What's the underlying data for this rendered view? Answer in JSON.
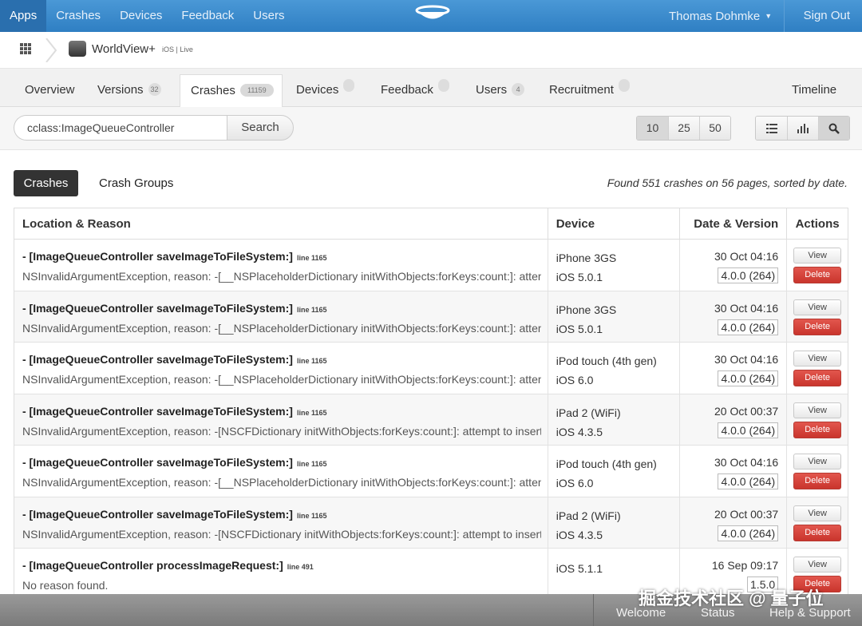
{
  "topnav": {
    "items": [
      "Apps",
      "Crashes",
      "Devices",
      "Feedback",
      "Users"
    ],
    "user": "Thomas Dohmke",
    "signout": "Sign Out"
  },
  "breadcrumb": {
    "app_name": "WorldView+",
    "app_sub": "iOS | Live"
  },
  "tabs": [
    {
      "label": "Overview",
      "badge": null
    },
    {
      "label": "Versions",
      "badge": "32"
    },
    {
      "label": "Crashes",
      "badge": "11159"
    },
    {
      "label": "Devices",
      "badge": ""
    },
    {
      "label": "Feedback",
      "badge": ""
    },
    {
      "label": "Users",
      "badge": "4"
    },
    {
      "label": "Recruitment",
      "badge": ""
    },
    {
      "label": "Timeline",
      "badge": null
    }
  ],
  "search": {
    "value": "cclass:ImageQueueController",
    "button": "Search"
  },
  "pager": [
    "10",
    "25",
    "50"
  ],
  "subtabs": {
    "active": "Crashes",
    "other": "Crash Groups"
  },
  "found_text": "Found 551 crashes on 56 pages, sorted by date.",
  "table": {
    "headers": [
      "Location & Reason",
      "Device",
      "Date & Version",
      "Actions"
    ],
    "view_label": "View",
    "delete_label": "Delete",
    "rows": [
      {
        "method": "- [ImageQueueController saveImageToFileSystem:]",
        "line": "line 1165",
        "reason": "NSInvalidArgumentException, reason: -[__NSPlaceholderDictionary initWithObjects:forKeys:count:]: attempt to insert nil object",
        "device": "iPhone 3GS",
        "os": "iOS 5.0.1",
        "date": "30 Oct 04:16",
        "version": "4.0.0 (264)"
      },
      {
        "method": "- [ImageQueueController saveImageToFileSystem:]",
        "line": "line 1165",
        "reason": "NSInvalidArgumentException, reason: -[__NSPlaceholderDictionary initWithObjects:forKeys:count:]: attempt to insert nil object",
        "device": "iPhone 3GS",
        "os": "iOS 5.0.1",
        "date": "30 Oct 04:16",
        "version": "4.0.0 (264)"
      },
      {
        "method": "- [ImageQueueController saveImageToFileSystem:]",
        "line": "line 1165",
        "reason": "NSInvalidArgumentException, reason: -[__NSPlaceholderDictionary initWithObjects:forKeys:count:]: attempt to insert nil object",
        "device": "iPod touch (4th gen)",
        "os": "iOS 6.0",
        "date": "30 Oct 04:16",
        "version": "4.0.0 (264)"
      },
      {
        "method": "- [ImageQueueController saveImageToFileSystem:]",
        "line": "line 1165",
        "reason": "NSInvalidArgumentException, reason: -[NSCFDictionary initWithObjects:forKeys:count:]: attempt to insert nil object",
        "device": "iPad 2 (WiFi)",
        "os": "iOS 4.3.5",
        "date": "20 Oct 00:37",
        "version": "4.0.0 (264)"
      },
      {
        "method": "- [ImageQueueController saveImageToFileSystem:]",
        "line": "line 1165",
        "reason": "NSInvalidArgumentException, reason: -[__NSPlaceholderDictionary initWithObjects:forKeys:count:]: attempt to insert nil object",
        "device": "iPod touch (4th gen)",
        "os": "iOS 6.0",
        "date": "30 Oct 04:16",
        "version": "4.0.0 (264)"
      },
      {
        "method": "- [ImageQueueController saveImageToFileSystem:]",
        "line": "line 1165",
        "reason": "NSInvalidArgumentException, reason: -[NSCFDictionary initWithObjects:forKeys:count:]: attempt to insert nil object",
        "device": "iPad 2 (WiFi)",
        "os": "iOS 4.3.5",
        "date": "20 Oct 00:37",
        "version": "4.0.0 (264)"
      },
      {
        "method": "- [ImageQueueController processImageRequest:]",
        "line": "line 491",
        "reason": "No reason found.",
        "device": "",
        "os": "iOS 5.1.1",
        "date": "16 Sep 09:17",
        "version": "1.5.0"
      }
    ]
  },
  "footer": {
    "links": [
      "Welcome",
      "Status",
      "Help & Support"
    ]
  },
  "watermark": "掘金技术社区 @ 量子位",
  "colors": {
    "topbar": "#3a8ccc",
    "delete": "#d2453c",
    "pill": "#333333",
    "footer": "#8a8a8a"
  }
}
